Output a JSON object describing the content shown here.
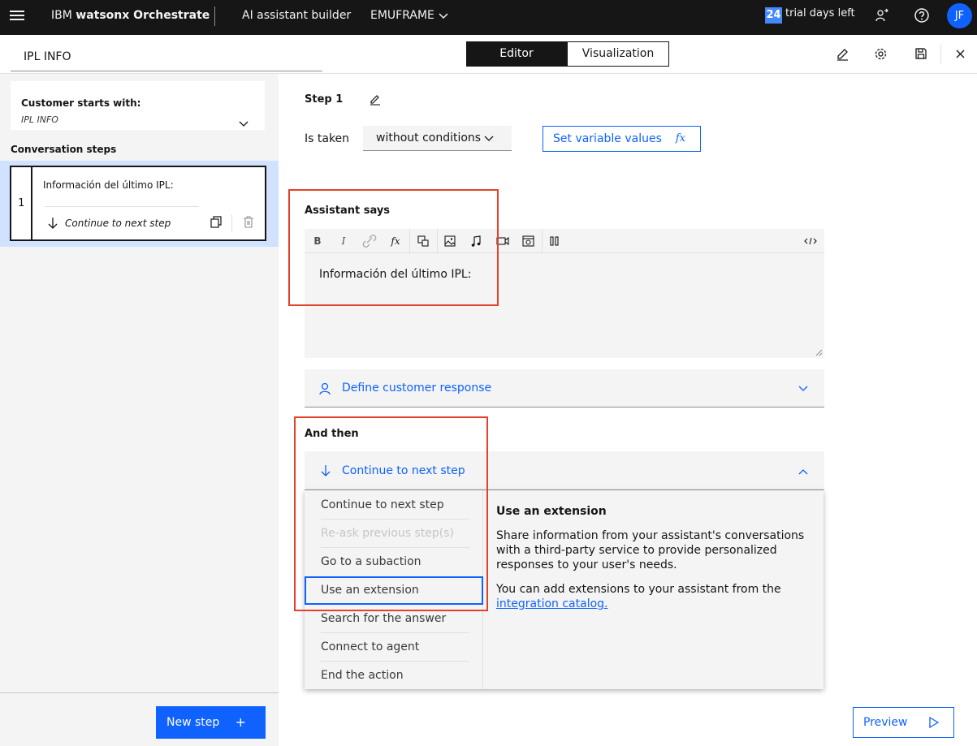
{
  "header": {
    "brand_prefix": "IBM",
    "brand_name": "watsonx Orchestrate",
    "nav_item": "AI assistant builder",
    "instance": "EMUFRAME",
    "trial_days": "24",
    "trial_text": "trial days left",
    "avatar_initials": "JF"
  },
  "subheader": {
    "action_title": "IPL INFO",
    "tab_editor": "Editor",
    "tab_visualization": "Visualization"
  },
  "sidebar": {
    "starts_label": "Customer starts with:",
    "starts_value": "IPL INFO",
    "steps_heading": "Conversation steps",
    "step": {
      "number": "1",
      "text": "Información del último IPL:",
      "next": "Continue to next step"
    },
    "new_step_label": "New step",
    "new_step_plus": "+"
  },
  "main": {
    "step_title": "Step 1",
    "is_taken_label": "Is taken",
    "condition_value": "without conditions",
    "set_variable_label": "Set variable values",
    "fx_symbol": "fx",
    "assistant_says_title": "Assistant says",
    "toolbar": {
      "bold": "B",
      "italic": "I"
    },
    "editor_text": "Información del último IPL:",
    "define_response_label": "Define customer response",
    "and_then_title": "And then",
    "and_then_value": "Continue to next step",
    "menu_items": [
      {
        "label": "Continue to next step"
      },
      {
        "label": "Re-ask previous step(s)"
      },
      {
        "label": "Go to a subaction"
      },
      {
        "label": "Use an extension"
      },
      {
        "label": "Search for the answer"
      },
      {
        "label": "Connect to agent"
      },
      {
        "label": "End the action"
      }
    ],
    "description": {
      "title": "Use an extension",
      "p1": "Share information from your assistant's conversations with a third-party service to provide personalized responses to your user's needs.",
      "p2_prefix": "You can add extensions to your assistant from the",
      "p2_link": "integration catalog."
    },
    "preview_label": "Preview"
  },
  "colors": {
    "accent": "#0f62fe",
    "highlight": "#e5412a",
    "header_bg": "#161616"
  }
}
